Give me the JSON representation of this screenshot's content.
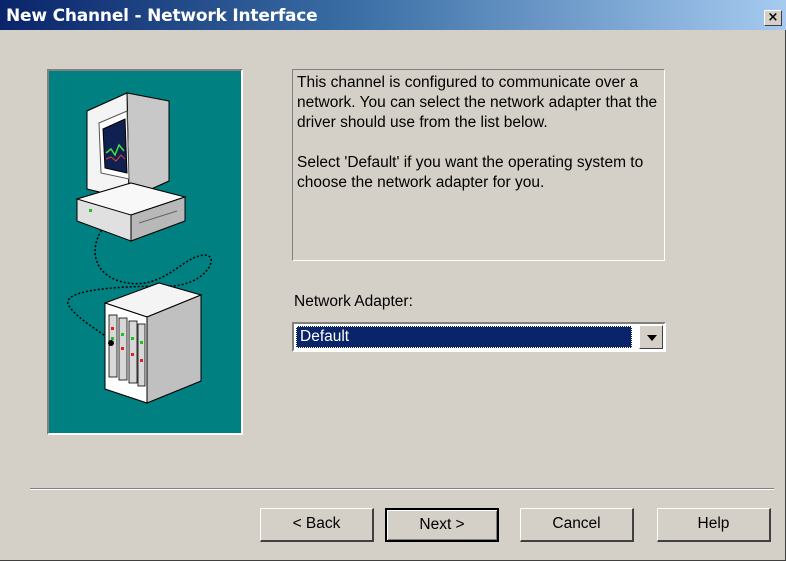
{
  "window": {
    "title": "New Channel - Network Interface",
    "close_glyph": "×"
  },
  "illustration": {
    "icon": "computer-network-device-icon",
    "background_color": "#008080"
  },
  "description": {
    "paragraph1": "This channel is configured to communicate over a network.  You can select the network adapter that the driver should use from the list below.",
    "paragraph2": "Select 'Default' if you want the operating system to choose the network adapter for you."
  },
  "network_adapter": {
    "label": "Network Adapter:",
    "selected": "Default"
  },
  "buttons": {
    "back": "< Back",
    "next": "Next >",
    "cancel": "Cancel",
    "help": "Help"
  }
}
